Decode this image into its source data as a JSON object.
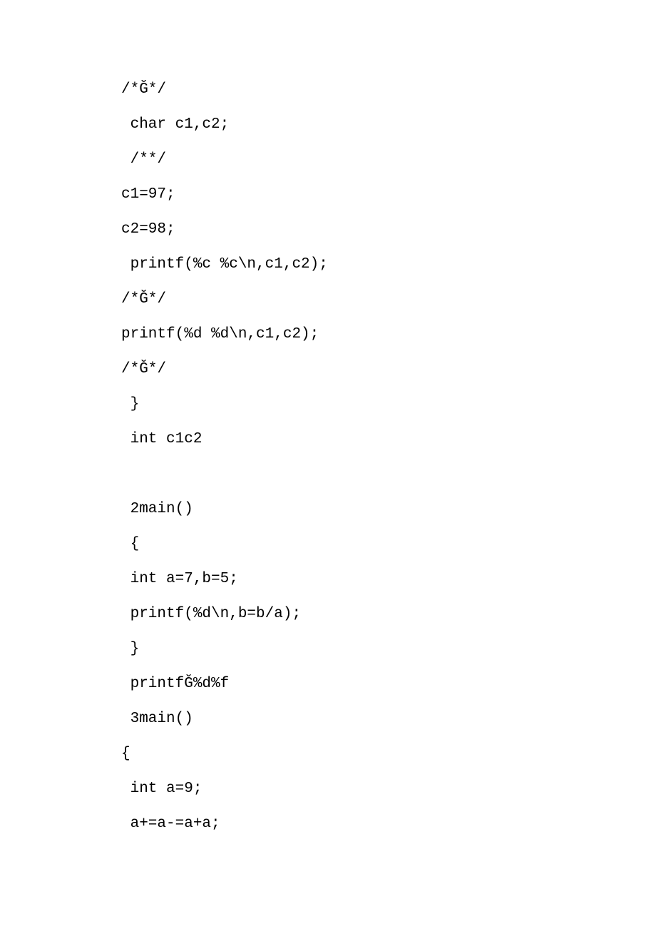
{
  "lines": [
    "/*Ğ*/",
    " char c1,c2;",
    " /**/",
    "c1=97;",
    "c2=98;",
    " printf(%c %c\\n,c1,c2);",
    "/*Ğ*/",
    "printf(%d %d\\n,c1,c2);",
    "/*Ğ*/",
    " }",
    " int c1c2",
    "",
    " 2main()",
    " {",
    " int a=7,b=5;",
    " printf(%d\\n,b=b/a);",
    " }",
    " printfĞ%d%f",
    " 3main()",
    "{",
    " int a=9;",
    " a+=a-=a+a;"
  ]
}
